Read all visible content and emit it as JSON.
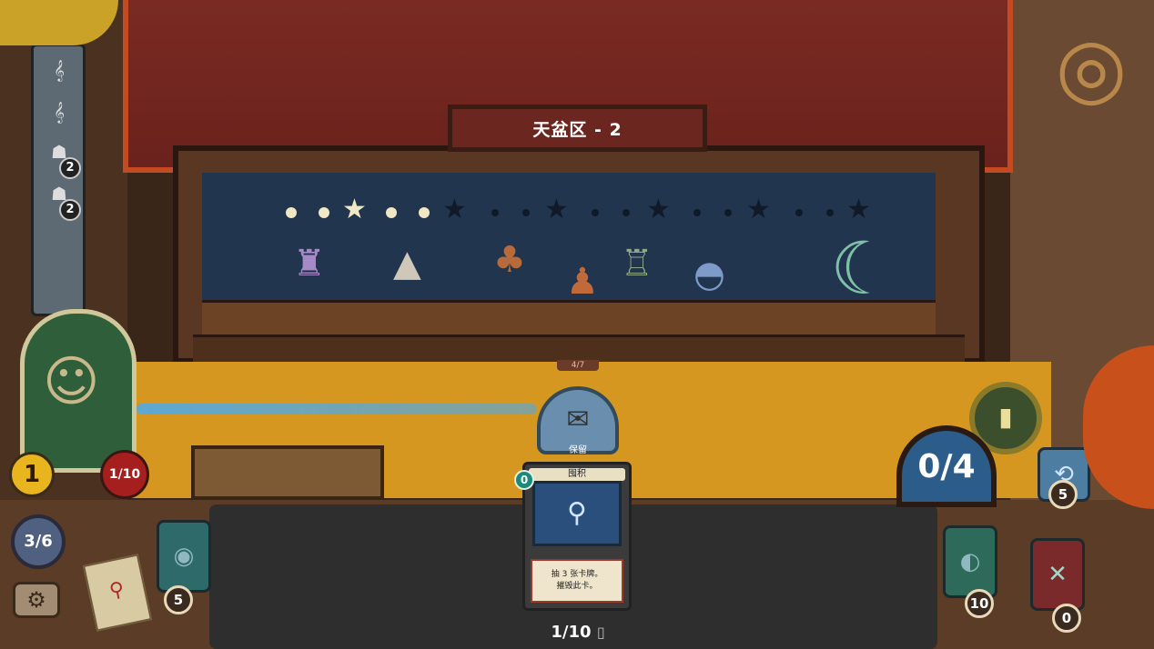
{
  "stage": {
    "title": "天盆区 - 2",
    "progress_stars": {
      "lit": 1,
      "total": 5
    },
    "props": [
      "castle",
      "pyramid",
      "scarecrow",
      "tree",
      "robot",
      "lighthouse",
      "observatory",
      "moon"
    ]
  },
  "player": {
    "gold": "1",
    "hp": "1/10",
    "round": "3/6",
    "inventory": [
      {
        "icon": "violin-icon",
        "count": ""
      },
      {
        "icon": "violin-icon",
        "count": ""
      },
      {
        "icon": "agent-icon",
        "count": "2"
      },
      {
        "icon": "agent-icon",
        "count": "2"
      }
    ]
  },
  "decks": {
    "draw_count": "5",
    "discard_count": "10",
    "exhaust_count": "0",
    "right_top_count": "5"
  },
  "energy": "0/4",
  "hand": {
    "keep_label": "保留",
    "card": {
      "name": "囤积",
      "cost": "0",
      "text_line1": "抽 3 张卡牌。",
      "text_line2": "摧毁此卡。"
    },
    "deck_counter": "1/10",
    "pointer_label": "4/7"
  },
  "colors": {
    "curtain": "#7a2a22",
    "table": "#d5971f",
    "sky": "#22354e",
    "energy": "#2b5c8a",
    "hp": "#a51f1f",
    "gold": "#e8b51e"
  }
}
